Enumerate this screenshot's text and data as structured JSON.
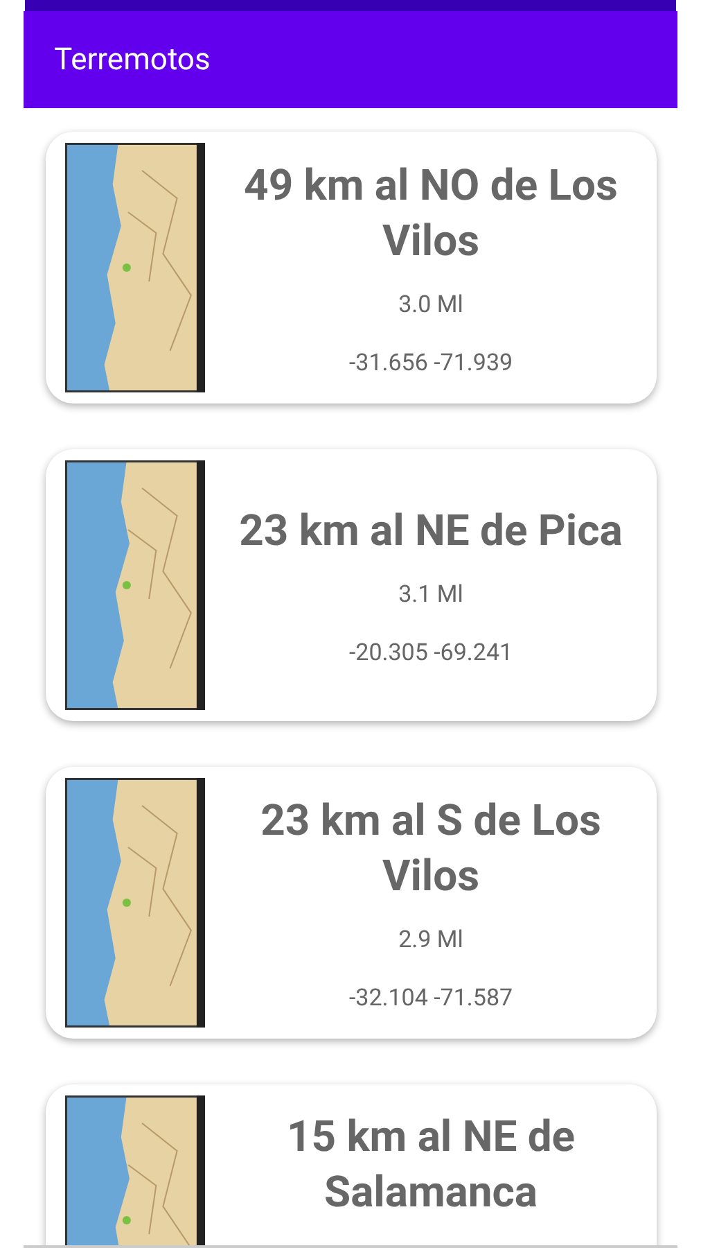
{
  "app_bar": {
    "title": "Terremotos"
  },
  "earthquakes": [
    {
      "place": "49 km al NO de Los Vilos",
      "magnitude": "3.0 Ml",
      "coordinates": "-31.656 -71.939"
    },
    {
      "place": "23 km al NE de Pica",
      "magnitude": "3.1 Ml",
      "coordinates": "-20.305 -69.241"
    },
    {
      "place": "23 km al S de Los Vilos",
      "magnitude": "2.9 Ml",
      "coordinates": "-32.104 -71.587"
    },
    {
      "place": "15 km al NE de Salamanca"
    }
  ]
}
